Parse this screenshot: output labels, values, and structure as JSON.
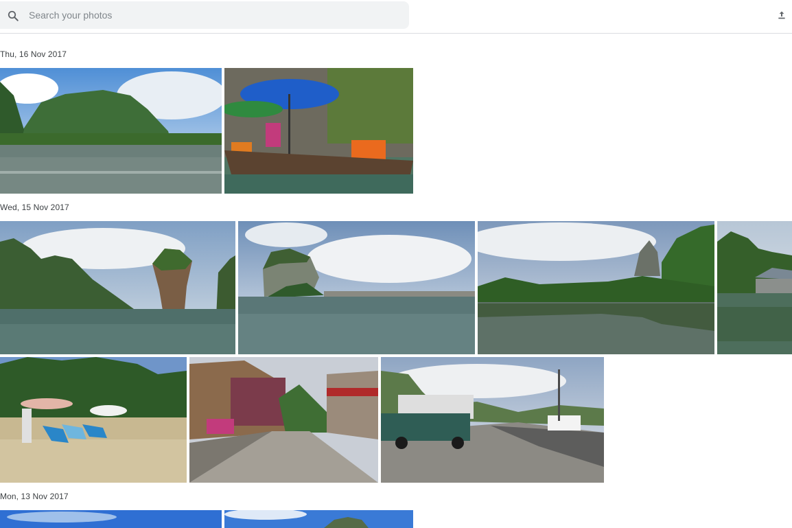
{
  "search": {
    "placeholder": "Search your photos"
  },
  "toolbar": {
    "upload_icon": "upload-icon"
  },
  "groups": [
    {
      "date": "Thu, 16 Nov 2017",
      "photos": [
        "karst-island-bay",
        "longtail-boat-umbrellas"
      ]
    },
    {
      "date": "Wed, 15 Nov 2017",
      "photos": [
        "james-bond-island",
        "limestone-rock-village",
        "mangrove-reflection",
        "stilt-house-river"
      ]
    },
    {
      "date": "",
      "photos": [
        "beach-loungers",
        "village-street",
        "songthaew-roadside"
      ]
    },
    {
      "date": "Mon, 13 Nov 2017",
      "photos": [
        "sky-beach-1",
        "sky-beach-2"
      ]
    }
  ]
}
